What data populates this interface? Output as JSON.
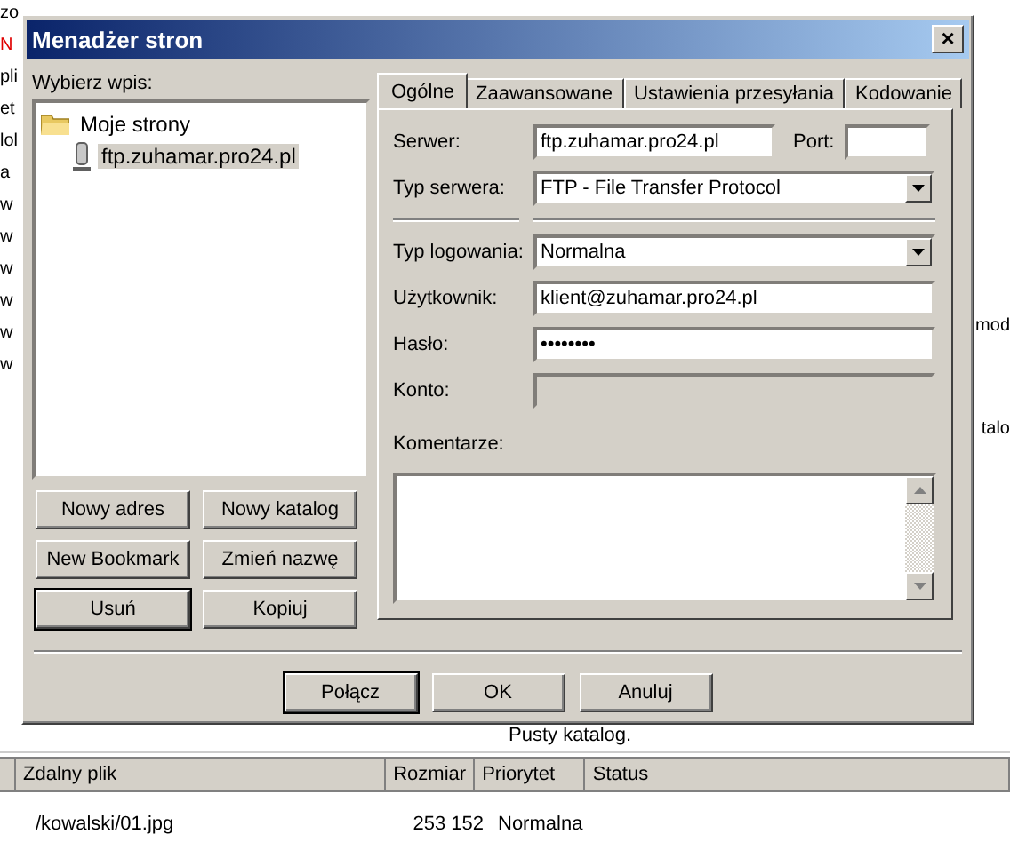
{
  "background": {
    "left_fragments": [
      {
        "text": "zo",
        "alert": false
      },
      {
        "text": "N",
        "alert": true
      },
      {
        "text": "pli",
        "alert": false
      },
      {
        "text": "et",
        "alert": false
      },
      {
        "text": "lol",
        "alert": false
      },
      {
        "text": "a",
        "alert": false
      },
      {
        "text": "w",
        "alert": false
      },
      {
        "text": "w",
        "alert": false
      },
      {
        "text": "w",
        "alert": false
      },
      {
        "text": "w",
        "alert": false
      },
      {
        "text": "w",
        "alert": false
      },
      {
        "text": "w",
        "alert": false
      }
    ],
    "right_fragments": [
      "mod",
      "talo"
    ],
    "status_text": "Pusty katalog.",
    "queue_columns": [
      "Zdalny plik",
      "Rozmiar",
      "Priorytet",
      "Status"
    ],
    "queue_rows": [
      {
        "file": "/kowalski/01.jpg",
        "size": "253 152",
        "priority": "Normalna"
      }
    ]
  },
  "window": {
    "title": "Menadżer stron",
    "close": "×"
  },
  "select_label": "Wybierz wpis:",
  "tree": [
    {
      "label": "Moje strony",
      "kind": "folder",
      "selected": false,
      "children": [
        {
          "label": "ftp.zuhamar.pro24.pl",
          "kind": "site",
          "selected": true
        }
      ]
    }
  ],
  "tree_buttons": [
    {
      "label": "Nowy adres",
      "default": false
    },
    {
      "label": "Nowy katalog",
      "default": false
    },
    {
      "label": "New Bookmark",
      "default": false
    },
    {
      "label": "Zmień nazwę",
      "default": false
    },
    {
      "label": "Usuń",
      "default": true
    },
    {
      "label": "Kopiuj",
      "default": false
    }
  ],
  "tabs": [
    {
      "label": "Ogólne",
      "selected": true
    },
    {
      "label": "Zaawansowane",
      "selected": false
    },
    {
      "label": "Ustawienia przesyłania",
      "selected": false
    },
    {
      "label": "Kodowanie",
      "selected": false
    }
  ],
  "general": {
    "server_label": "Serwer:",
    "server": "ftp.zuhamar.pro24.pl",
    "port_label": "Port:",
    "server_type_label": "Typ serwera:",
    "server_type": "FTP - File Transfer Protocol",
    "logon_type_label": "Typ logowania:",
    "logon_type": "Normalna",
    "user_label": "Użytkownik:",
    "user": "klient@zuhamar.pro24.pl",
    "password_label": "Hasło:",
    "password": "••••••••",
    "account_label": "Konto:",
    "account_disabled": true,
    "comments_label": "Komentarze:"
  },
  "dialog_buttons": [
    {
      "label": "Połącz",
      "default": true
    },
    {
      "label": "OK",
      "default": false
    },
    {
      "label": "Anuluj",
      "default": false
    }
  ]
}
